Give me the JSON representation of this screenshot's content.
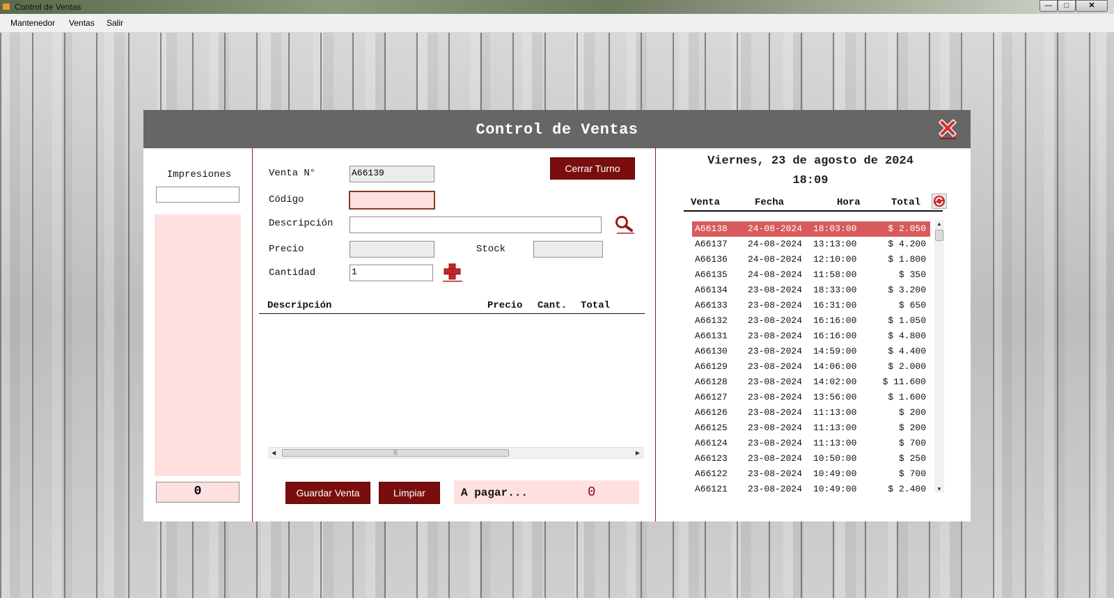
{
  "window": {
    "title": "Control de Ventas"
  },
  "menu": {
    "items": [
      "Mantenedor",
      "Ventas",
      "Salir"
    ]
  },
  "dialog": {
    "title": "Control de Ventas"
  },
  "left_panel": {
    "impresiones_label": "Impresiones",
    "impresiones_value": "",
    "counter": "0"
  },
  "form": {
    "venta_label": "Venta N°",
    "venta_value": "A66139",
    "codigo_label": "Código",
    "codigo_value": "",
    "descripcion_label": "Descripción",
    "descripcion_value": "",
    "precio_label": "Precio",
    "precio_value": "",
    "stock_label": "Stock",
    "stock_value": "",
    "cantidad_label": "Cantidad",
    "cantidad_value": "1",
    "cerrar_turno": "Cerrar Turno"
  },
  "items_table": {
    "headers": {
      "descripcion": "Descripción",
      "precio": "Precio",
      "cant": "Cant.",
      "total": "Total"
    },
    "rows": []
  },
  "footer": {
    "guardar": "Guardar Venta",
    "limpiar": "Limpiar",
    "a_pagar_label": "A pagar...",
    "a_pagar_value": "0"
  },
  "right_panel": {
    "date": "Viernes, 23 de agosto de 2024",
    "time": "18:09",
    "headers": {
      "venta": "Venta",
      "fecha": "Fecha",
      "hora": "Hora",
      "total": "Total"
    },
    "sales": [
      {
        "venta": "A66138",
        "fecha": "24-08-2024",
        "hora": "18:03:00",
        "total": "$ 2.050",
        "selected": true
      },
      {
        "venta": "A66137",
        "fecha": "24-08-2024",
        "hora": "13:13:00",
        "total": "$ 4.200"
      },
      {
        "venta": "A66136",
        "fecha": "24-08-2024",
        "hora": "12:10:00",
        "total": "$ 1.800"
      },
      {
        "venta": "A66135",
        "fecha": "24-08-2024",
        "hora": "11:58:00",
        "total": "$ 350"
      },
      {
        "venta": "A66134",
        "fecha": "23-08-2024",
        "hora": "18:33:00",
        "total": "$ 3.200"
      },
      {
        "venta": "A66133",
        "fecha": "23-08-2024",
        "hora": "16:31:00",
        "total": "$ 650"
      },
      {
        "venta": "A66132",
        "fecha": "23-08-2024",
        "hora": "16:16:00",
        "total": "$ 1.050"
      },
      {
        "venta": "A66131",
        "fecha": "23-08-2024",
        "hora": "16:16:00",
        "total": "$ 4.800"
      },
      {
        "venta": "A66130",
        "fecha": "23-08-2024",
        "hora": "14:59:00",
        "total": "$ 4.400"
      },
      {
        "venta": "A66129",
        "fecha": "23-08-2024",
        "hora": "14:06:00",
        "total": "$ 2.000"
      },
      {
        "venta": "A66128",
        "fecha": "23-08-2024",
        "hora": "14:02:00",
        "total": "$ 11.600"
      },
      {
        "venta": "A66127",
        "fecha": "23-08-2024",
        "hora": "13:56:00",
        "total": "$ 1.600"
      },
      {
        "venta": "A66126",
        "fecha": "23-08-2024",
        "hora": "11:13:00",
        "total": "$ 200"
      },
      {
        "venta": "A66125",
        "fecha": "23-08-2024",
        "hora": "11:13:00",
        "total": "$ 200"
      },
      {
        "venta": "A66124",
        "fecha": "23-08-2024",
        "hora": "11:13:00",
        "total": "$ 700"
      },
      {
        "venta": "A66123",
        "fecha": "23-08-2024",
        "hora": "10:50:00",
        "total": "$ 250"
      },
      {
        "venta": "A66122",
        "fecha": "23-08-2024",
        "hora": "10:49:00",
        "total": "$ 700"
      },
      {
        "venta": "A66121",
        "fecha": "23-08-2024",
        "hora": "10:49:00",
        "total": "$ 2.400"
      }
    ]
  },
  "colors": {
    "accent": "#7a0e0e",
    "header": "#666666",
    "pink": "#ffe0e0",
    "selected_row": "#d85a5a"
  },
  "icons": [
    "search-icon",
    "add-icon",
    "refresh-icon",
    "close-icon"
  ]
}
